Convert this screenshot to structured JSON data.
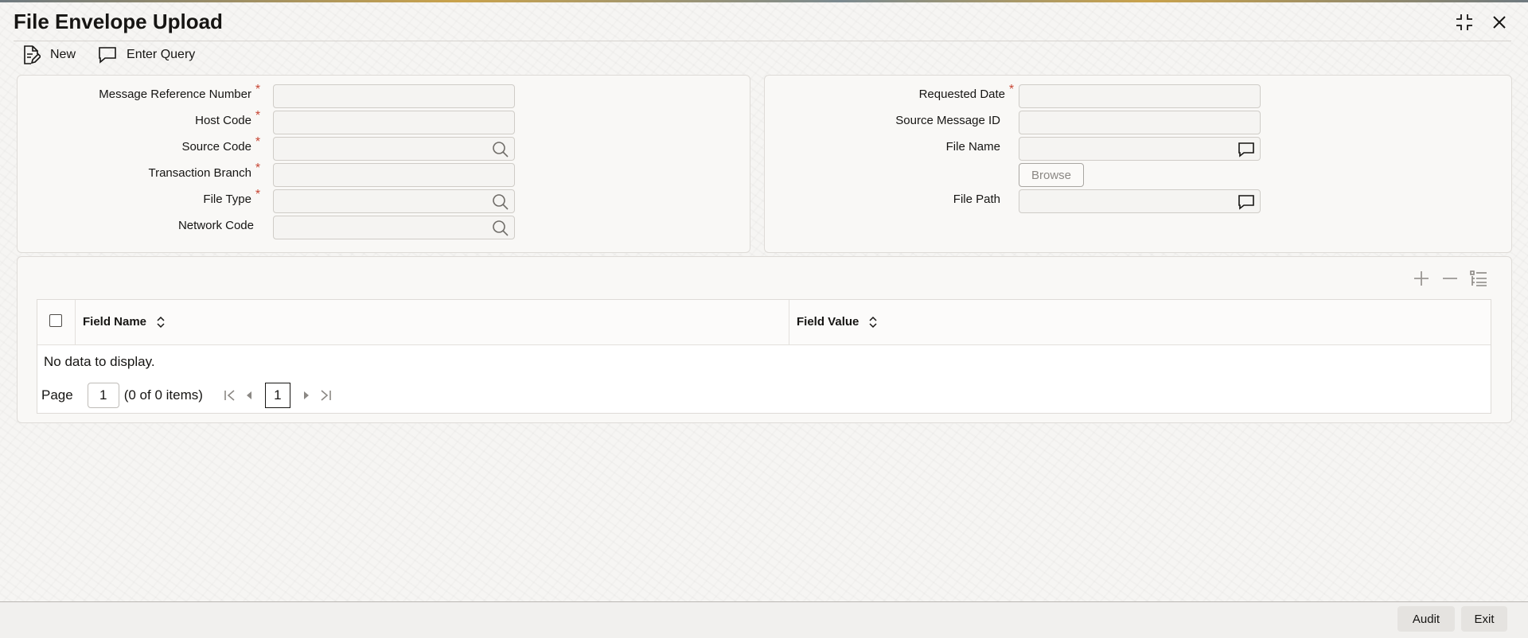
{
  "window": {
    "title": "File Envelope Upload",
    "icons": [
      "maximize-icon",
      "close-icon"
    ]
  },
  "toolbar": {
    "new_label": "New",
    "enter_query_label": "Enter Query"
  },
  "left_form": {
    "message_reference_number": "Message Reference Number",
    "host_code": "Host Code",
    "source_code": "Source Code",
    "transaction_branch": "Transaction Branch",
    "file_type": "File Type",
    "network_code": "Network Code",
    "required_mark": "*"
  },
  "right_form": {
    "requested_date": "Requested Date",
    "source_message_id": "Source Message ID",
    "file_name": "File Name",
    "browse_label": "Browse",
    "file_path": "File Path",
    "required_mark": "*"
  },
  "grid": {
    "columns": [
      "Field Name",
      "Field Value"
    ],
    "empty_text": "No data to display.",
    "page_label": "Page",
    "page_value": "1",
    "items_text": "(0 of 0 items)",
    "current_page": "1"
  },
  "footer": {
    "audit_label": "Audit",
    "exit_label": "Exit"
  },
  "colors": {
    "required": "#c74634",
    "text": "#161513"
  }
}
